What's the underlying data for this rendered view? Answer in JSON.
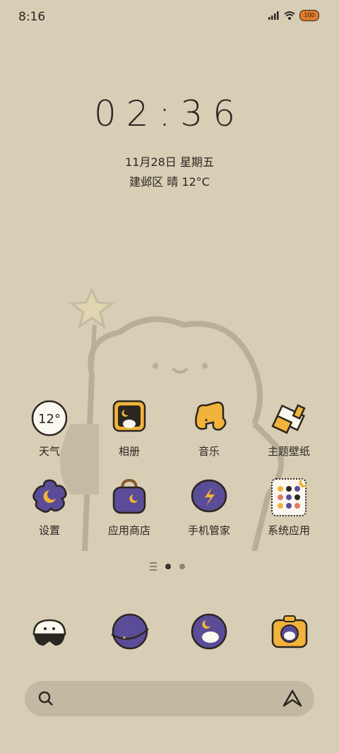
{
  "status_bar": {
    "time": "8:16",
    "battery": "100"
  },
  "lock": {
    "clock": "02:36",
    "date": "11月28日 星期五",
    "weather": "建邺区 晴 12°C"
  },
  "apps": [
    {
      "label": "天气",
      "icon": "weather-icon",
      "temp": "12°"
    },
    {
      "label": "相册",
      "icon": "gallery-icon"
    },
    {
      "label": "音乐",
      "icon": "music-icon"
    },
    {
      "label": "主题壁纸",
      "icon": "theme-icon"
    },
    {
      "label": "设置",
      "icon": "settings-icon"
    },
    {
      "label": "应用商店",
      "icon": "app-store-icon"
    },
    {
      "label": "手机管家",
      "icon": "phone-manager-icon"
    },
    {
      "label": "系统应用",
      "icon": "system-apps-folder-icon"
    }
  ],
  "dock": [
    {
      "icon": "contacts-icon"
    },
    {
      "icon": "browser-icon"
    },
    {
      "icon": "messages-icon"
    },
    {
      "icon": "camera-icon"
    }
  ],
  "colors": {
    "background": "#d8ceb6",
    "accent_yellow": "#f2b33a",
    "accent_purple": "#5a4c96",
    "outline": "#2b2620"
  }
}
